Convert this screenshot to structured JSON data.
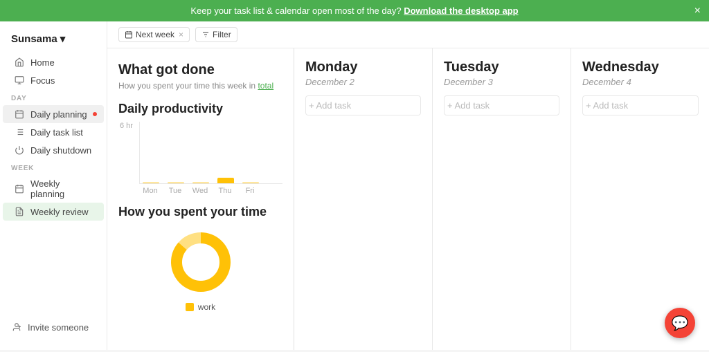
{
  "banner": {
    "message": "Keep your task list & calendar open most of the day?",
    "cta": "Download the desktop app",
    "close_label": "×"
  },
  "sidebar": {
    "brand": "Sunsama",
    "brand_arrow": "▾",
    "nav": [
      {
        "id": "home",
        "label": "Home",
        "icon": "home"
      },
      {
        "id": "focus",
        "label": "Focus",
        "icon": "focus"
      }
    ],
    "day_section": "DAY",
    "day_items": [
      {
        "id": "daily-planning",
        "label": "Daily planning",
        "icon": "calendar",
        "active": true,
        "dot": true
      },
      {
        "id": "daily-task-list",
        "label": "Daily task list",
        "icon": "list"
      },
      {
        "id": "daily-shutdown",
        "label": "Daily shutdown",
        "icon": "shutdown"
      }
    ],
    "week_section": "WEEK",
    "week_items": [
      {
        "id": "weekly-planning",
        "label": "Weekly planning",
        "icon": "calendar"
      },
      {
        "id": "weekly-review",
        "label": "Weekly review",
        "icon": "review",
        "active": true
      }
    ],
    "bottom": {
      "label": "Invite someone",
      "icon": "person-add"
    }
  },
  "toolbar": {
    "next_week": "Next week",
    "close": "×",
    "filter": "Filter"
  },
  "weekly_panel": {
    "title": "What got done",
    "subtitle": "How you spent your time this week in",
    "subtitle_link": "total",
    "productivity_title": "Daily productivity",
    "chart": {
      "y_label": "6 hr",
      "bars": [
        {
          "day": "Mon",
          "height": 0
        },
        {
          "day": "Tue",
          "height": 0
        },
        {
          "day": "Wed",
          "height": 0
        },
        {
          "day": "Thu",
          "height": 8
        },
        {
          "day": "Fri",
          "height": 0
        }
      ]
    },
    "time_title": "How you spent your time",
    "legend": [
      {
        "label": "work",
        "color": "#ffc107"
      }
    ]
  },
  "days": [
    {
      "name": "Monday",
      "date": "December 2",
      "add_task_label": "+ Add task"
    },
    {
      "name": "Tuesday",
      "date": "December 3",
      "add_task_label": "+ Add task"
    },
    {
      "name": "Wednesday",
      "date": "December 4",
      "add_task_label": "+ Add task"
    }
  ],
  "fab": {
    "icon": "💬"
  }
}
